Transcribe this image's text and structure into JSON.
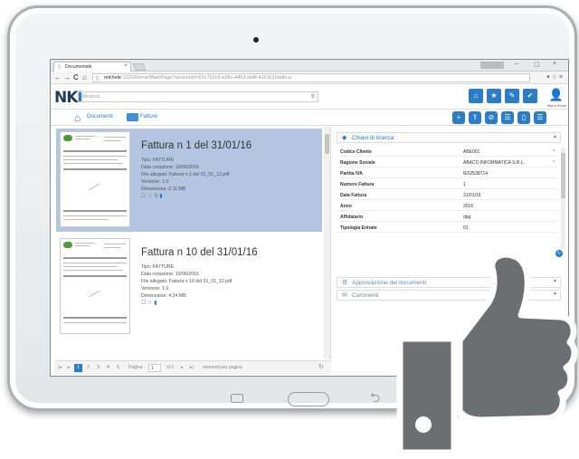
{
  "browser": {
    "tab_title": "Documentale",
    "tab_close": "×",
    "url_host": "michele",
    "url_path": ":1320/Home/MainPage?sessionId=61c791c6-e98c-4d63-afd4-4163c10adbca",
    "controls": {
      "minimize": "–",
      "maximize": "▢",
      "close": "×"
    },
    "nav": {
      "back": "←",
      "forward": "→",
      "reload": "C",
      "home": "⌂"
    },
    "chrome_icons": "▾ ☆ ≡"
  },
  "app": {
    "logo_main": "NK",
    "logo_accent": "I",
    "search_placeholder": "Ricerca...",
    "user_name": "Mario Rossi",
    "header_buttons": [
      "⌂",
      "★",
      "✎",
      "✔"
    ],
    "toolbar_buttons": [
      "+",
      "⇪",
      "⊘",
      "☰",
      "▯",
      "☰"
    ]
  },
  "breadcrumb": {
    "documents_label": "Documenti",
    "folder_label": "Fatture"
  },
  "documents": [
    {
      "title": "Fattura n 1 del 31/01/16",
      "type": "Tipo: FATTURE",
      "created": "Data creazione: 10/06/2016",
      "file": "File allegato: Fattura n 1 del 31_01_12.pdf",
      "version": "Versione: 1.0",
      "size": "Dimensione: 2.11 MB",
      "icons": [
        "☐",
        "☆",
        "⚲",
        "▮"
      ]
    },
    {
      "title": "Fattura n 10 del 31/01/16",
      "type": "Tipo: FATTURE",
      "created": "Data creazione: 10/06/2016",
      "file": "File allegato: Fattura n 10 del 31_01_12.pdf",
      "version": "Versione: 1.0",
      "size": "Dimensione: 4.24 MB",
      "icons": [
        "☐",
        "☆",
        "▮"
      ]
    }
  ],
  "pager": {
    "first": "|◂",
    "prev": "◂",
    "pages": [
      "1",
      "2",
      "3",
      "4",
      "5"
    ],
    "active_page": "1",
    "page_label": "Pagina",
    "page_value": "1",
    "of_label": "di 5",
    "next": "▸",
    "last": "▸|",
    "per_page_label": "elementi per pagina",
    "refresh": "↻"
  },
  "detail": {
    "keys_title": "Chiavi di ricerca",
    "properties": [
      {
        "key": "Codice Cliente",
        "value": "ABE001",
        "clearable": true
      },
      {
        "key": "Ragione Sociale",
        "value": "ABACO INFORMATICA S.R.L.",
        "clearable": true
      },
      {
        "key": "Partita IVA",
        "value": "IE52538714",
        "clearable": false
      },
      {
        "key": "Numero Fattura",
        "value": "1",
        "clearable": false
      },
      {
        "key": "Data Fattura",
        "value": "31/01/16",
        "clearable": false
      },
      {
        "key": "Anno",
        "value": "2016",
        "clearable": false
      },
      {
        "key": "Affidatario",
        "value": "dpg",
        "clearable": false
      },
      {
        "key": "Tipologia Entrate",
        "value": "01",
        "clearable": false
      }
    ],
    "clear_glyph": "×",
    "approval_title": "Approvazione dei documenti",
    "comments_title": "Commenti"
  },
  "colors": {
    "accent": "#2b7dc4",
    "selected_row": "#b3c5e0",
    "thumbs_up": "#6d6e71"
  }
}
